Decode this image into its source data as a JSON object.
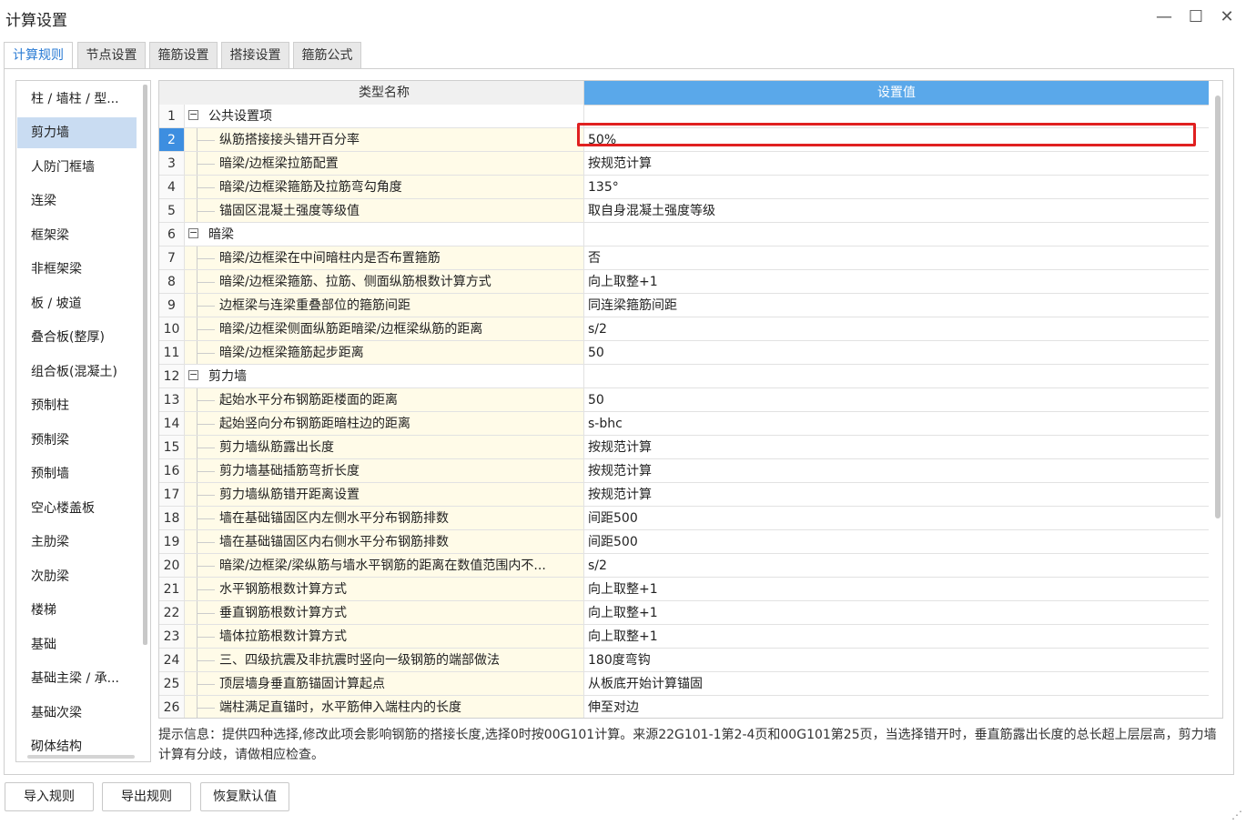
{
  "window": {
    "title": "计算设置",
    "minimize": "—",
    "maximize": "☐",
    "close": "✕"
  },
  "tabs": [
    {
      "label": "计算规则",
      "active": true
    },
    {
      "label": "节点设置"
    },
    {
      "label": "箍筋设置"
    },
    {
      "label": "搭接设置"
    },
    {
      "label": "箍筋公式"
    }
  ],
  "left_list": [
    {
      "label": "柱 / 墙柱 / 型..."
    },
    {
      "label": "剪力墙",
      "active": true
    },
    {
      "label": "人防门框墙"
    },
    {
      "label": "连梁"
    },
    {
      "label": "框架梁"
    },
    {
      "label": "非框架梁"
    },
    {
      "label": "板 / 坡道"
    },
    {
      "label": "叠合板(整厚)"
    },
    {
      "label": "组合板(混凝土)"
    },
    {
      "label": "预制柱"
    },
    {
      "label": "预制梁"
    },
    {
      "label": "预制墙"
    },
    {
      "label": "空心楼盖板"
    },
    {
      "label": "主肋梁"
    },
    {
      "label": "次肋梁"
    },
    {
      "label": "楼梯"
    },
    {
      "label": "基础"
    },
    {
      "label": "基础主梁 / 承..."
    },
    {
      "label": "基础次梁"
    },
    {
      "label": "砌体结构"
    }
  ],
  "grid": {
    "header_name": "类型名称",
    "header_value": "设置值",
    "rows": [
      {
        "num": "1",
        "name": "公共设置项",
        "value": "",
        "group": true,
        "toggle": "−"
      },
      {
        "num": "2",
        "name": "纵筋搭接接头错开百分率",
        "value": "50%",
        "selected": true
      },
      {
        "num": "3",
        "name": "暗梁/边框梁拉筋配置",
        "value": "按规范计算"
      },
      {
        "num": "4",
        "name": "暗梁/边框梁箍筋及拉筋弯勾角度",
        "value": "135°"
      },
      {
        "num": "5",
        "name": "锚固区混凝土强度等级值",
        "value": "取自身混凝土强度等级"
      },
      {
        "num": "6",
        "name": "暗梁",
        "value": "",
        "group": true,
        "toggle": "−"
      },
      {
        "num": "7",
        "name": "暗梁/边框梁在中间暗柱内是否布置箍筋",
        "value": "否"
      },
      {
        "num": "8",
        "name": "暗梁/边框梁箍筋、拉筋、侧面纵筋根数计算方式",
        "value": "向上取整+1"
      },
      {
        "num": "9",
        "name": "边框梁与连梁重叠部位的箍筋间距",
        "value": "同连梁箍筋间距"
      },
      {
        "num": "10",
        "name": "暗梁/边框梁侧面纵筋距暗梁/边框梁纵筋的距离",
        "value": "s/2"
      },
      {
        "num": "11",
        "name": "暗梁/边框梁箍筋起步距离",
        "value": "50"
      },
      {
        "num": "12",
        "name": "剪力墙",
        "value": "",
        "group": true,
        "toggle": "−"
      },
      {
        "num": "13",
        "name": "起始水平分布钢筋距楼面的距离",
        "value": "50"
      },
      {
        "num": "14",
        "name": "起始竖向分布钢筋距暗柱边的距离",
        "value": "s-bhc"
      },
      {
        "num": "15",
        "name": "剪力墙纵筋露出长度",
        "value": "按规范计算"
      },
      {
        "num": "16",
        "name": "剪力墙基础插筋弯折长度",
        "value": "按规范计算"
      },
      {
        "num": "17",
        "name": "剪力墙纵筋错开距离设置",
        "value": "按规范计算"
      },
      {
        "num": "18",
        "name": "墙在基础锚固区内左侧水平分布钢筋排数",
        "value": "间距500"
      },
      {
        "num": "19",
        "name": "墙在基础锚固区内右侧水平分布钢筋排数",
        "value": "间距500"
      },
      {
        "num": "20",
        "name": "暗梁/边框梁/梁纵筋与墙水平钢筋的距离在数值范围内不...",
        "value": "s/2"
      },
      {
        "num": "21",
        "name": "水平钢筋根数计算方式",
        "value": "向上取整+1"
      },
      {
        "num": "22",
        "name": "垂直钢筋根数计算方式",
        "value": "向上取整+1"
      },
      {
        "num": "23",
        "name": "墙体拉筋根数计算方式",
        "value": "向上取整+1"
      },
      {
        "num": "24",
        "name": "三、四级抗震及非抗震时竖向一级钢筋的端部做法",
        "value": "180度弯钩"
      },
      {
        "num": "25",
        "name": "顶层墙身垂直筋锚固计算起点",
        "value": "从板底开始计算锚固"
      },
      {
        "num": "26",
        "name": "端柱满足直锚时，水平筋伸入端柱内的长度",
        "value": "伸至对边"
      }
    ]
  },
  "hint": "提示信息：提供四种选择,修改此项会影响钢筋的搭接长度,选择0时按00G101计算。来源22G101-1第2-4页和00G101第25页，当选择错开时，垂直筋露出长度的总长超上层层高，剪力墙计算有分歧，请做相应检查。",
  "buttons": {
    "import": "导入规则",
    "export": "导出规则",
    "restore": "恢复默认值"
  },
  "colors": {
    "accent": "#2a7bd4",
    "header_value_bg": "#5aa8ea",
    "highlight_box": "#e02020",
    "name_cell_bg": "#fffbe8"
  }
}
